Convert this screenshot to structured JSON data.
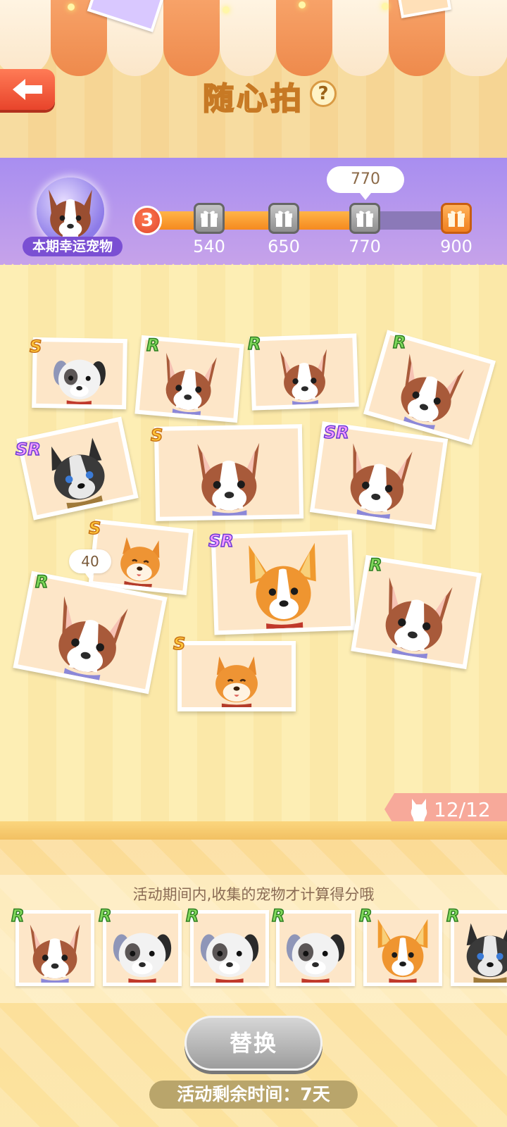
{
  "header": {
    "title": "随心拍",
    "back_icon": "back-arrow-icon",
    "help_icon": "question-mark-icon",
    "help_label": "?"
  },
  "progress": {
    "lucky_pet_label": "本期幸运宠物",
    "level": "3",
    "current_score_bubble": "770",
    "fill_fraction": 0.73,
    "milestones": [
      {
        "value": "540",
        "icon": "gift-icon",
        "state": "claimed"
      },
      {
        "value": "650",
        "icon": "gift-icon",
        "state": "claimed"
      },
      {
        "value": "770",
        "icon": "gift-icon",
        "state": "claimed"
      },
      {
        "value": "900",
        "icon": "gift-icon",
        "state": "next"
      }
    ]
  },
  "wall": {
    "photos": [
      {
        "rarity": "S",
        "pet": "panda-dog"
      },
      {
        "rarity": "R",
        "pet": "boston-terrier"
      },
      {
        "rarity": "R",
        "pet": "boston-terrier"
      },
      {
        "rarity": "R",
        "pet": "boston-terrier"
      },
      {
        "rarity": "SR",
        "pet": "husky"
      },
      {
        "rarity": "S",
        "pet": "boston-terrier"
      },
      {
        "rarity": "SR",
        "pet": "boston-terrier"
      },
      {
        "rarity": "S",
        "pet": "shiba"
      },
      {
        "rarity": "SR",
        "pet": "corgi"
      },
      {
        "rarity": "R",
        "pet": "boston-terrier"
      },
      {
        "rarity": "R",
        "pet": "boston-terrier"
      },
      {
        "rarity": "S",
        "pet": "shiba"
      }
    ],
    "score_bubble": "40",
    "count_icon": "cat-silhouette-icon",
    "count": "12/12"
  },
  "collection": {
    "hint": "活动期间内,收集的宠物才计算得分哦",
    "items": [
      {
        "rarity": "R",
        "pet": "boston-terrier"
      },
      {
        "rarity": "R",
        "pet": "panda-dog"
      },
      {
        "rarity": "R",
        "pet": "panda-dog"
      },
      {
        "rarity": "R",
        "pet": "panda-dog"
      },
      {
        "rarity": "R",
        "pet": "corgi"
      },
      {
        "rarity": "R",
        "pet": "husky"
      }
    ]
  },
  "actions": {
    "replace_label": "替换",
    "timer_label": "活动剩余时间：",
    "timer_value": "7天"
  },
  "colors": {
    "accent_orange": "#f58a1f",
    "panel_purple": "#a88ef0",
    "rarity_R": "#7fd85b",
    "rarity_S": "#ffc53a",
    "rarity_SR": "#f59bff"
  }
}
